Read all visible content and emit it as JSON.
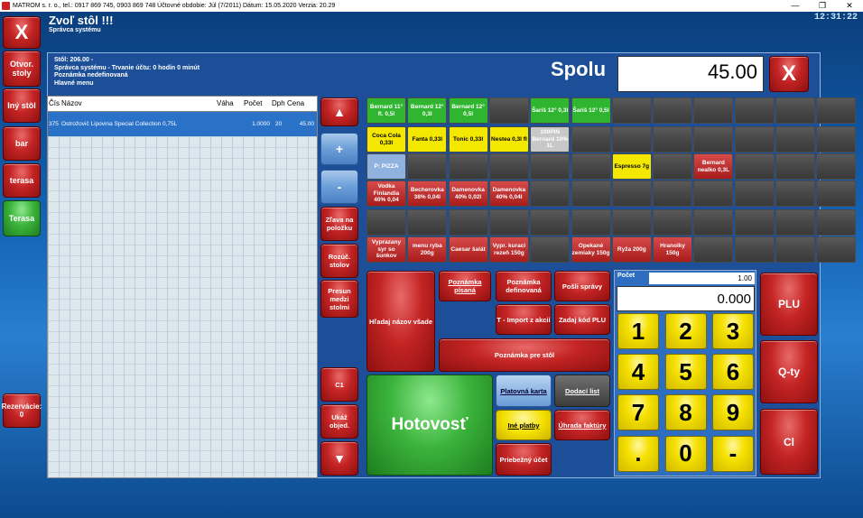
{
  "titlebar": {
    "text": "MATROM s. r. o., tel.: 0917 869 745, 0903 869 748  Účtovné obdobie: Júl (7/2011)  Dátum: 15.05.2020  Verzia: 20.29",
    "min": "—",
    "max": "❐",
    "close": "✕"
  },
  "clock": "12:31:22",
  "header": {
    "title": "Zvoľ stôl !!!",
    "subtitle": "Správca systému"
  },
  "sidebar": {
    "close": "X",
    "items": [
      "Otvor. stoly",
      "Iný stôl",
      "bar",
      "terasa",
      "Terasa"
    ],
    "reservations": "Rezervácie: 0"
  },
  "info": {
    "lines": [
      "Stôl: 206.00 -",
      "Správca systému - Trvanie účtu: 0 hodín 0 minút",
      "Poznámka nedefinovaná",
      "Hlavné menu"
    ]
  },
  "total": {
    "label": "Spolu",
    "value": "45.00",
    "close": "X"
  },
  "table": {
    "headers": [
      "Čís",
      "Názov",
      "Váha",
      "Počet",
      "Dph",
      "Cena"
    ],
    "rows": [
      [
        "375",
        "Ostrožovič Lipovina Special Collection 0,75L",
        "",
        "1.0000",
        "20",
        "45.00"
      ]
    ]
  },
  "mid": {
    "up": "▲",
    "plus": "+",
    "minus": "-",
    "discount": "Zľava na položku",
    "split": "Rozúč. stolov",
    "move": "Presun medzi stolmi",
    "c1": "C1",
    "show": "Ukáž objed.",
    "down": "▼"
  },
  "products": [
    [
      "Bernard 11° fl. 0,5l",
      "Bernard 12° 0,3l",
      "Bernard 12° 0,5l",
      "",
      "Šariš 12° 0,3l",
      "Šariš 12° 0,5l",
      "",
      "",
      "",
      "",
      "",
      ""
    ],
    [
      "Coca Cola 0,33l",
      "Fanta 0,33l",
      "Tonic 0,33l",
      "Nestea 0,3l fl",
      "100PIN Bernard 10% 1L",
      "",
      "",
      "",
      "",
      "",
      "",
      ""
    ],
    [
      "P: PIZZA",
      "",
      "",
      "",
      "",
      "",
      "Espresso 7g",
      "",
      "Bernard nealko 0,3L",
      "",
      "",
      ""
    ],
    [
      "Vodka Finlandia 40% 0,04",
      "Becherovka 38% 0,04l",
      "Damenovka 40% 0,02l",
      "Damenovka 40% 0,04l",
      "",
      "",
      "",
      "",
      "",
      "",
      "",
      ""
    ],
    [
      "",
      "",
      "",
      "",
      "",
      "",
      "",
      "",
      "",
      "",
      "",
      ""
    ],
    [
      "Vyprazany syr so šunkov",
      "menu ryba 200g",
      "Caesar šalát",
      "Vypr. kuraci rezeň 150g",
      "",
      "Opekané zemiaky 150g",
      "Ryža 200g",
      "Hranolky 150g",
      "",
      "",
      "",
      ""
    ]
  ],
  "actions": {
    "search": "Hľadaj názov všade",
    "note_written": "Poznámka písaná",
    "note_defined": "Poznámka definovaná",
    "send": "Pošli správy",
    "import": "T - Import z akcií",
    "code": "Zadaj kód PLU",
    "note_receipt": "Poznámka pre stôl",
    "cash": "Hotovosť",
    "card": "Platovná karta",
    "delivery": "Dodací list",
    "other": "Iné platby",
    "invoice": "Úhrada faktúry",
    "running": "Priebežný účet"
  },
  "numpad": {
    "count_label": "Počet",
    "count_value": "1.00",
    "display": "0.000",
    "keys": [
      "1",
      "2",
      "3",
      "4",
      "5",
      "6",
      "7",
      "8",
      "9",
      ".",
      "0",
      "-"
    ]
  },
  "right": {
    "plu": "PLU",
    "qty": "Q-ty",
    "cl": "Cl"
  },
  "colors": {
    "accent": "#1d4f98",
    "red": "#c42424",
    "green": "#3cb43c",
    "yellow": "#f5e100"
  }
}
